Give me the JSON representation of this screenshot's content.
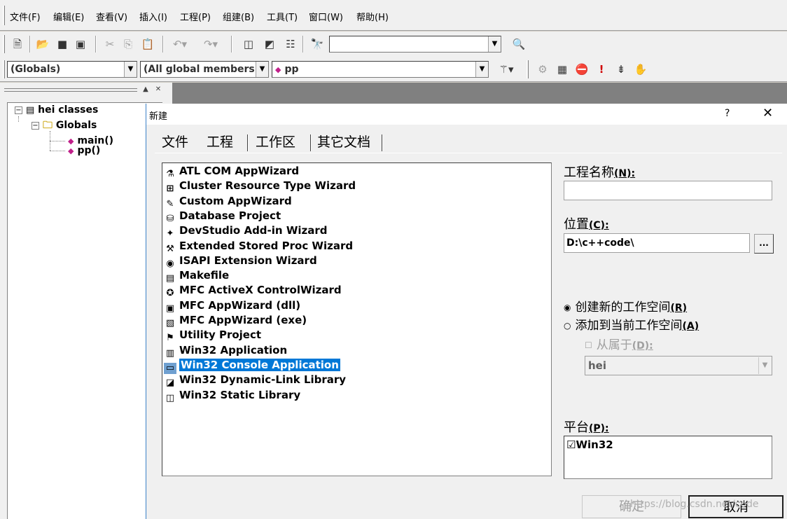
{
  "menu": [
    "文件(F)",
    "编辑(E)",
    "查看(V)",
    "插入(I)",
    "工程(P)",
    "组建(B)",
    "工具(T)",
    "窗口(W)",
    "帮助(H)"
  ],
  "toolbar1": {
    "find_combo_value": ""
  },
  "toolbar2": {
    "class_combo": "(Globals)",
    "members_combo": "(All global members",
    "func_combo": "pp"
  },
  "class_tree": {
    "root": "hei classes",
    "folder": "Globals",
    "items": [
      "main()",
      "pp()"
    ]
  },
  "dialog": {
    "title": "新建",
    "help": "?",
    "close": "✕",
    "tabs": [
      "文件",
      "工程",
      "工作区",
      "其它文档"
    ],
    "projects": [
      {
        "label": "ATL COM AppWizard",
        "icon": "atl-icon"
      },
      {
        "label": "Cluster Resource Type Wizard",
        "icon": "cluster-icon"
      },
      {
        "label": "Custom AppWizard",
        "icon": "custom-icon"
      },
      {
        "label": "Database Project",
        "icon": "database-icon"
      },
      {
        "label": "DevStudio Add-in Wizard",
        "icon": "addin-icon"
      },
      {
        "label": "Extended Stored Proc Wizard",
        "icon": "storedproc-icon"
      },
      {
        "label": "ISAPI Extension Wizard",
        "icon": "isapi-icon"
      },
      {
        "label": "Makefile",
        "icon": "makefile-icon"
      },
      {
        "label": "MFC ActiveX ControlWizard",
        "icon": "activex-icon"
      },
      {
        "label": "MFC AppWizard (dll)",
        "icon": "mfc-dll-icon"
      },
      {
        "label": "MFC AppWizard (exe)",
        "icon": "mfc-exe-icon"
      },
      {
        "label": "Utility Project",
        "icon": "utility-icon"
      },
      {
        "label": "Win32 Application",
        "icon": "win32-app-icon"
      },
      {
        "label": "Win32 Console Application",
        "icon": "console-icon",
        "selected": true
      },
      {
        "label": "Win32 Dynamic-Link Library",
        "icon": "dll-icon"
      },
      {
        "label": "Win32 Static Library",
        "icon": "lib-icon"
      }
    ],
    "project_name_label": "工程名称",
    "project_name_key": "(N):",
    "project_name_value": "",
    "location_label": "位置",
    "location_key": "(C):",
    "location_value": "D:\\c++code\\",
    "browse_label": "...",
    "radio_new": "创建新的工作空间",
    "radio_new_key": "(R)",
    "radio_add": "添加到当前工作空间",
    "radio_add_key": "(A)",
    "dependency_label": "从属于",
    "dependency_key": "(D):",
    "dependency_value": "hei",
    "platform_label": "平台",
    "platform_key": "(P):",
    "platform_value": "Win32",
    "ok_label": "确定",
    "cancel_label": "取消"
  },
  "watermark": "https://blog.csdn.net/code"
}
